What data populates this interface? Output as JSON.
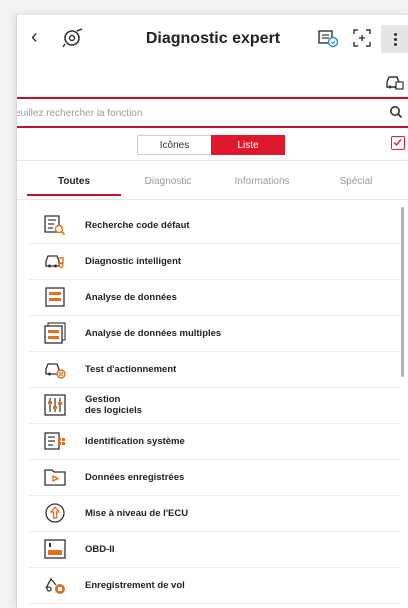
{
  "header": {
    "back_icon": "chevron-left-icon",
    "title": "Diagnostic expert"
  },
  "search": {
    "placeholder": "Veuillez rechercher la fonction"
  },
  "view_toggle": {
    "icons_label": "Icônes",
    "list_label": "Liste",
    "selected": "Liste"
  },
  "tabs": [
    {
      "label": "Toutes",
      "active": true
    },
    {
      "label": "Diagnostic",
      "active": false
    },
    {
      "label": "Informations",
      "active": false
    },
    {
      "label": "Spécial",
      "active": false
    }
  ],
  "functions": [
    {
      "label": "Recherche code défaut",
      "icon": "fault-code-search-icon"
    },
    {
      "label": "Diagnostic intelligent",
      "icon": "smart-diagnosis-icon"
    },
    {
      "label": "Analyse de données",
      "icon": "data-stream-icon"
    },
    {
      "label": "Analyse de données multiples",
      "icon": "multi-data-stream-icon"
    },
    {
      "label": "Test d'actionnement",
      "icon": "actuation-test-icon"
    },
    {
      "label": "Gestion\ndes logiciels",
      "icon": "software-management-icon"
    },
    {
      "label": "Identification système",
      "icon": "system-identification-icon"
    },
    {
      "label": "Données enregistrées",
      "icon": "recorded-data-icon"
    },
    {
      "label": "Mise à niveau de l'ECU",
      "icon": "ecu-upgrade-icon"
    },
    {
      "label": "OBD-II",
      "icon": "obd-ii-icon"
    },
    {
      "label": "Enregistrement de vol",
      "icon": "flight-record-icon"
    }
  ],
  "colors": {
    "accent": "#c8102e",
    "toggle_active": "#e0182d"
  }
}
